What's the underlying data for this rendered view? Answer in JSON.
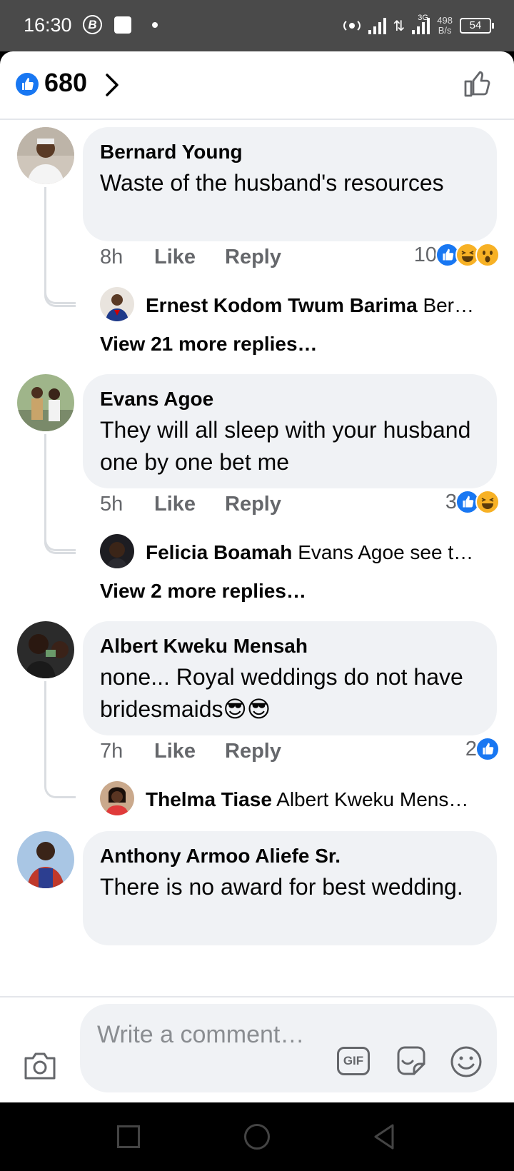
{
  "status_bar": {
    "time": "16:30",
    "b_icon": "B",
    "network_type": "3G",
    "speed_value": "498",
    "speed_unit": "B/s",
    "battery": "54"
  },
  "header": {
    "like_count": "680"
  },
  "comments": [
    {
      "author": "Bernard Young",
      "text": "Waste of the husband's resources",
      "time": "8h",
      "like_label": "Like",
      "reply_label": "Reply",
      "reaction_count": "10",
      "reactions": [
        "like",
        "haha",
        "wow"
      ],
      "reply_author": "Ernest Kodom Twum Barima",
      "reply_preview": "Ber…",
      "view_more": "View 21 more replies…"
    },
    {
      "author": "Evans Agoe",
      "text": "They will all  sleep with your husband one by one bet me",
      "time": "5h",
      "like_label": "Like",
      "reply_label": "Reply",
      "reaction_count": "3",
      "reactions": [
        "like",
        "haha"
      ],
      "reply_author": "Felicia Boamah",
      "reply_preview": "Evans Agoe see t…",
      "view_more": "View 2 more replies…"
    },
    {
      "author": "Albert Kweku Mensah",
      "text": "none... Royal weddings do not have bridesmaids😎😎",
      "time": "7h",
      "like_label": "Like",
      "reply_label": "Reply",
      "reaction_count": "2",
      "reactions": [
        "like"
      ],
      "reply_author": "Thelma Tiase",
      "reply_preview": "Albert Kweku Mens…"
    },
    {
      "author": "Anthony Armoo Aliefe Sr.",
      "text": "There is no award for best wedding."
    }
  ],
  "composer": {
    "placeholder": "Write a comment…",
    "gif_label": "GIF"
  },
  "colors": {
    "accent": "#1877f2",
    "bubble": "#f0f2f5",
    "muted_text": "#65676b"
  }
}
